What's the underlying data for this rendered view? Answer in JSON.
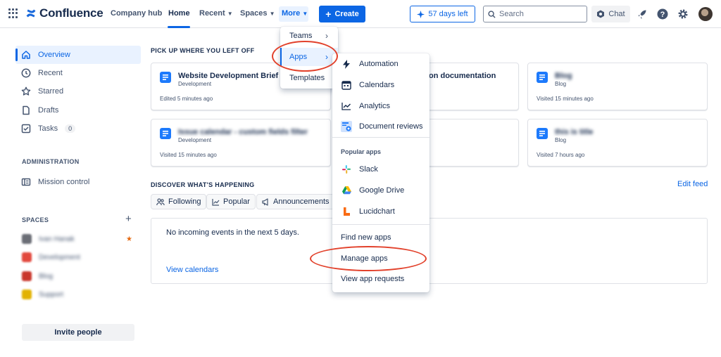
{
  "topbar": {
    "product": "Confluence",
    "nav": [
      "Company hub",
      "Home",
      "Recent",
      "Spaces",
      "More"
    ],
    "create_label": "Create",
    "trial_label": "57 days left",
    "search_placeholder": "Search",
    "chat_label": "Chat",
    "icons": [
      "app-switcher-icon",
      "confluence-logo-icon",
      "notifications-icon",
      "help-icon",
      "settings-icon",
      "avatar"
    ]
  },
  "sidebar": {
    "items": [
      {
        "label": "Overview",
        "icon": "home-icon",
        "active": true
      },
      {
        "label": "Recent",
        "icon": "clock-icon"
      },
      {
        "label": "Starred",
        "icon": "star-icon"
      },
      {
        "label": "Drafts",
        "icon": "draft-icon"
      },
      {
        "label": "Tasks",
        "icon": "checkbox-icon",
        "badge": "0"
      }
    ],
    "admin_heading": "ADMINISTRATION",
    "admin_item": "Mission control",
    "spaces_heading": "SPACES",
    "spaces": [
      {
        "name": "Ivan Hanak",
        "starred": true
      },
      {
        "name": "Development"
      },
      {
        "name": "Blog"
      },
      {
        "name": "Support"
      }
    ],
    "invite_label": "Invite people"
  },
  "main": {
    "pickup_title": "PICK UP WHERE YOU LEFT OFF",
    "cards": [
      {
        "title": "Website Development Brief",
        "space": "Development",
        "time": "Edited 5 minutes ago",
        "blurred": false
      },
      {
        "title": "on documentation",
        "space": "",
        "time": "",
        "blurred": false
      },
      {
        "title": "Blog",
        "space": "Blog",
        "time": "Visited 15 minutes ago",
        "blurred": true
      },
      {
        "title": "Issue calendar - custom fields filter",
        "space": "Development",
        "time": "Visited 15 minutes ago",
        "blurred": true
      },
      {
        "title": "",
        "space": "",
        "time": "",
        "blurred": false
      },
      {
        "title": "this is title",
        "space": "Blog",
        "time": "Visited 7 hours ago",
        "blurred": true
      }
    ],
    "discover_title": "DISCOVER WHAT'S HAPPENING",
    "edit_feed": "Edit feed",
    "filters": [
      "Following",
      "Popular",
      "Announcements"
    ],
    "events_text": "No incoming events in the next 5 days.",
    "view_calendars": "View calendars"
  },
  "more_menu": {
    "items": [
      "Teams",
      "Apps",
      "Templates"
    ],
    "highlighted": "Apps"
  },
  "apps_menu": {
    "items": [
      "Automation",
      "Calendars",
      "Analytics",
      "Document reviews"
    ],
    "popular_heading": "Popular apps",
    "popular": [
      "Slack",
      "Google Drive",
      "Lucidchart"
    ],
    "footer": [
      "Find new apps",
      "Manage apps",
      "View app requests"
    ]
  },
  "colors": {
    "brand": "#0c66e4",
    "annotation": "#e2412b",
    "text": "#172b4d",
    "subtle": "#44546f"
  }
}
